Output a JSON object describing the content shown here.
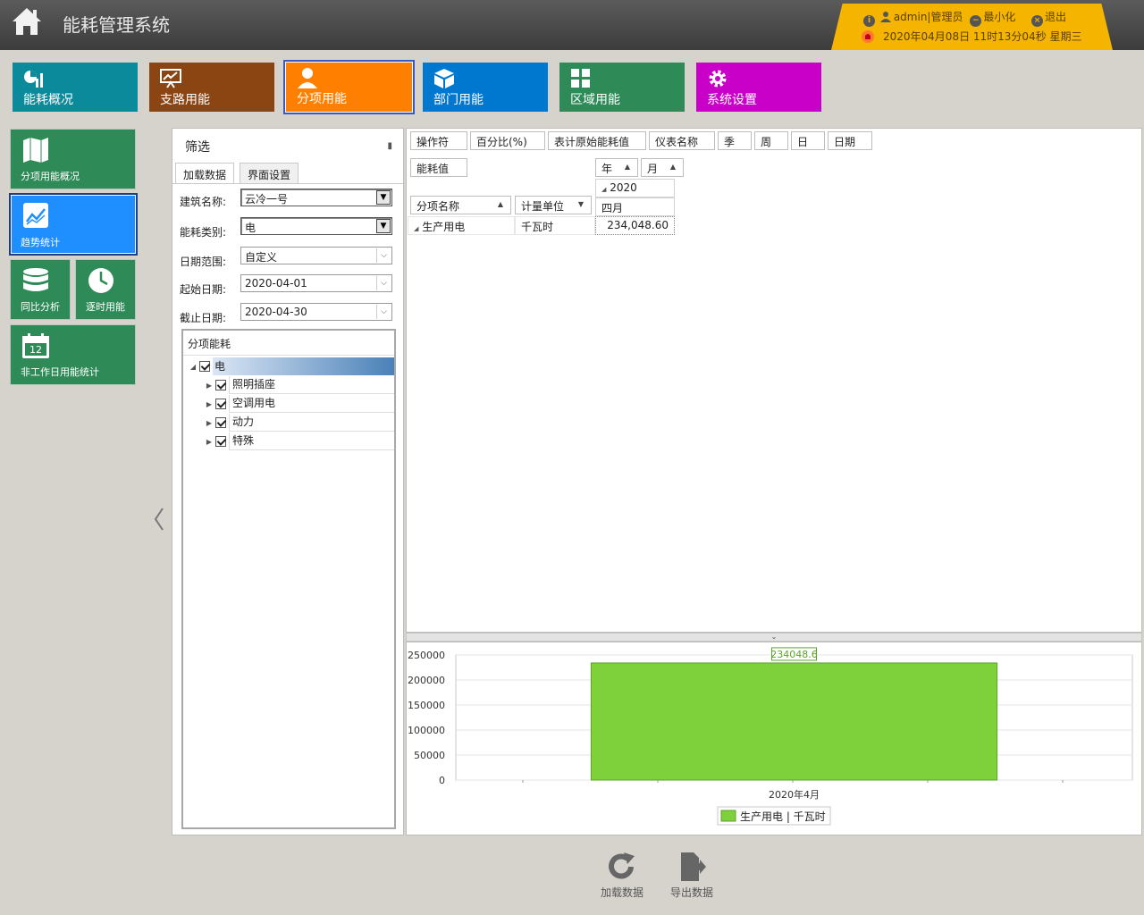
{
  "header": {
    "title": "能耗管理系统",
    "user_text": "admin|管理员",
    "minimize_label": "最小化",
    "logout_label": "退出",
    "datetime": "2020年04月08日 11时13分04秒 星期三"
  },
  "nav": {
    "tiles": [
      {
        "label": "能耗概况",
        "color": "#0a8a9a",
        "icon": "chart-icon"
      },
      {
        "label": "支路用能",
        "color": "#8b4513",
        "icon": "presentation-icon"
      },
      {
        "label": "分项用能",
        "color": "#ff8000",
        "icon": "person-icon",
        "active": true
      },
      {
        "label": "部门用能",
        "color": "#0078d0",
        "icon": "box-icon"
      },
      {
        "label": "区域用能",
        "color": "#2e8b57",
        "icon": "grid-icon"
      },
      {
        "label": "系统设置",
        "color": "#c800c8",
        "icon": "gear-icon"
      }
    ]
  },
  "side": {
    "items": [
      {
        "label": "分项用能概况"
      },
      {
        "label": "趋势统计"
      },
      {
        "label": "同比分析"
      },
      {
        "label": "逐时用能"
      },
      {
        "label": "非工作日用能统计"
      }
    ],
    "calendar_day": "12"
  },
  "filter": {
    "title": "筛选",
    "tab_load": "加载数据",
    "tab_ui": "界面设置",
    "building_label": "建筑名称:",
    "building_value": "云冷一号",
    "energy_label": "能耗类别:",
    "energy_value": "电",
    "range_label": "日期范围:",
    "range_value": "自定义",
    "start_label": "起始日期:",
    "start_value": "2020-04-01",
    "end_label": "截止日期:",
    "end_value": "2020-04-30",
    "tree_title": "分项能耗",
    "tree_root": "电",
    "tree_children": [
      "照明插座",
      "空调用电",
      "动力",
      "特殊"
    ]
  },
  "pivot": {
    "filter_fields": [
      "操作符",
      "百分比(%)",
      "表计原始能耗值",
      "仪表名称",
      "季",
      "周",
      "日",
      "日期"
    ],
    "data_field": "能耗值",
    "col_year": "年",
    "col_month": "月",
    "row_name": "分项名称",
    "row_unit": "计量单位",
    "year_value": "2020",
    "month_value": "四月",
    "row_item": "生产用电",
    "row_item_unit": "千瓦时",
    "cell_value": "234,048.60"
  },
  "chart_data": {
    "type": "bar",
    "categories": [
      "2020年4月"
    ],
    "series": [
      {
        "name": "生产用电 | 千瓦时",
        "values": [
          234048.6
        ],
        "color": "#7fd13b"
      }
    ],
    "data_label": "234048.6",
    "yticks": [
      "250000",
      "200000",
      "150000",
      "100000",
      "50000",
      "0"
    ],
    "ylim": [
      0,
      250000
    ],
    "legend_position": "bottom"
  },
  "bottom": {
    "load_label": "加载数据",
    "export_label": "导出数据"
  }
}
